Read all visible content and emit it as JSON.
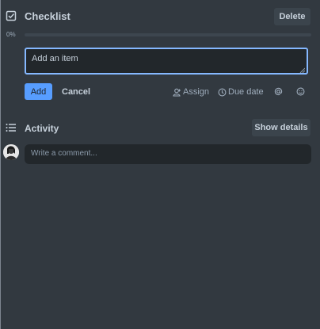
{
  "checklist": {
    "title": "Checklist",
    "delete_label": "Delete",
    "progress_label": "0%",
    "progress_fraction": 0
  },
  "item_input": {
    "value": "Add an item"
  },
  "actions": {
    "add_label": "Add",
    "cancel_label": "Cancel",
    "assign_label": "Assign",
    "due_date_label": "Due date"
  },
  "activity": {
    "title": "Activity",
    "show_details_label": "Show details",
    "comment_placeholder": "Write a comment..."
  },
  "icons": [
    "checkbox-icon",
    "assign-icon",
    "clock-icon",
    "mention-icon",
    "emoji-icon",
    "activity-list-icon",
    "avatar"
  ],
  "colors": {
    "background": "#323940",
    "accent": "#579dff",
    "input_focus_border": "#85b8ff"
  }
}
